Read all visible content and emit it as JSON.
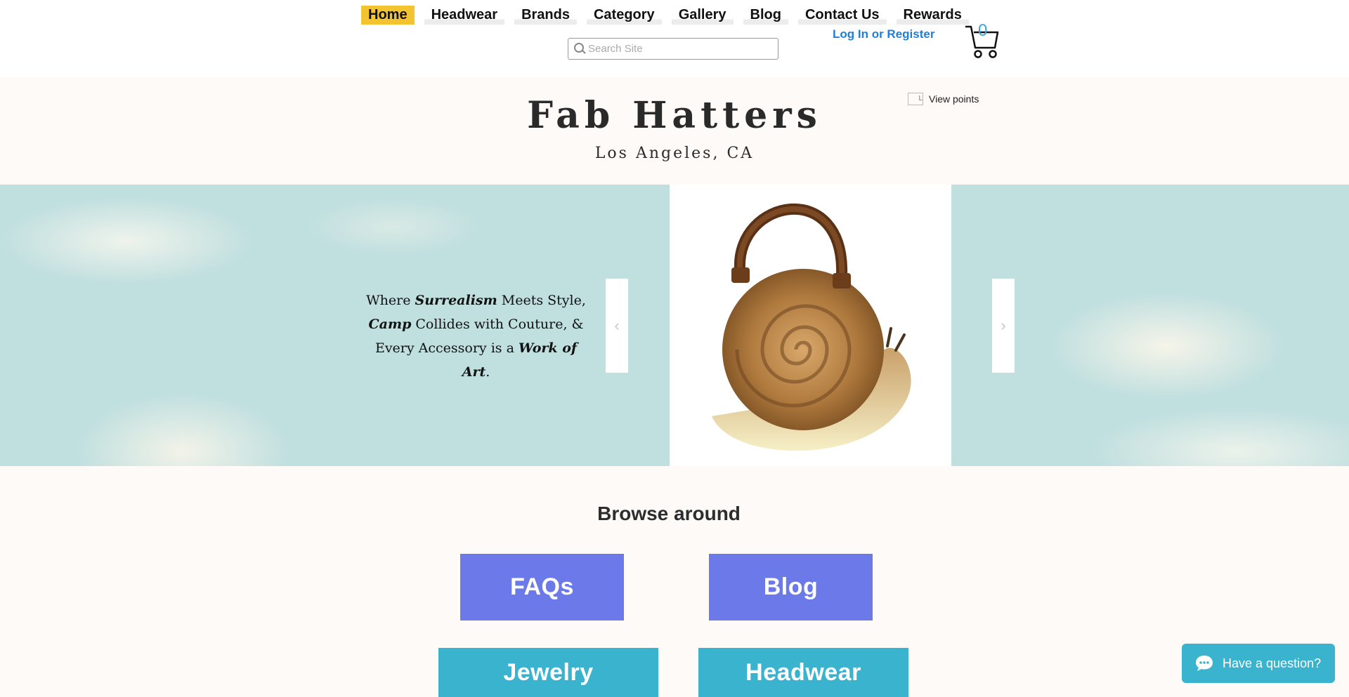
{
  "nav": {
    "items": [
      {
        "label": "Home",
        "active": true
      },
      {
        "label": "Headwear"
      },
      {
        "label": "Brands"
      },
      {
        "label": "Category"
      },
      {
        "label": "Gallery"
      },
      {
        "label": "Blog"
      },
      {
        "label": "Contact Us"
      },
      {
        "label": "Rewards"
      }
    ]
  },
  "search": {
    "placeholder": "Search Site"
  },
  "account": {
    "login_label": "Log In or Register"
  },
  "cart": {
    "count": "0",
    "icon": "cart-icon"
  },
  "loyalty": {
    "label": "View points",
    "image_alt": "L"
  },
  "header": {
    "title": "Fab Hatters",
    "subtitle": "Los Angeles, CA"
  },
  "hero": {
    "line1_a": "Where ",
    "line1_b": "Surrealism",
    "line1_c": " Meets Style,",
    "line2_a": "Camp",
    "line2_b": " Collides with Couture, &",
    "line3_a": "Every Accessory is a ",
    "line3_b": "Work of Art",
    "line3_c": ".",
    "prev_icon": "chevron-left-icon",
    "next_icon": "chevron-right-icon",
    "image": "snail-shaped leather handbag"
  },
  "browse": {
    "title": "Browse around",
    "tiles": [
      {
        "label": "FAQs",
        "color": "#6b7ae8"
      },
      {
        "label": "Blog",
        "color": "#6b7ae8"
      },
      {
        "label": "Jewelry",
        "color": "#3ab3cf"
      },
      {
        "label": "Headwear",
        "color": "#3ab3cf"
      }
    ]
  },
  "chat": {
    "label": "Have a question?",
    "icon": "chat-bubble-icon"
  },
  "colors": {
    "accent_nav": "#f4c430",
    "link": "#1e7fd8",
    "chat": "#3ab3cf"
  }
}
